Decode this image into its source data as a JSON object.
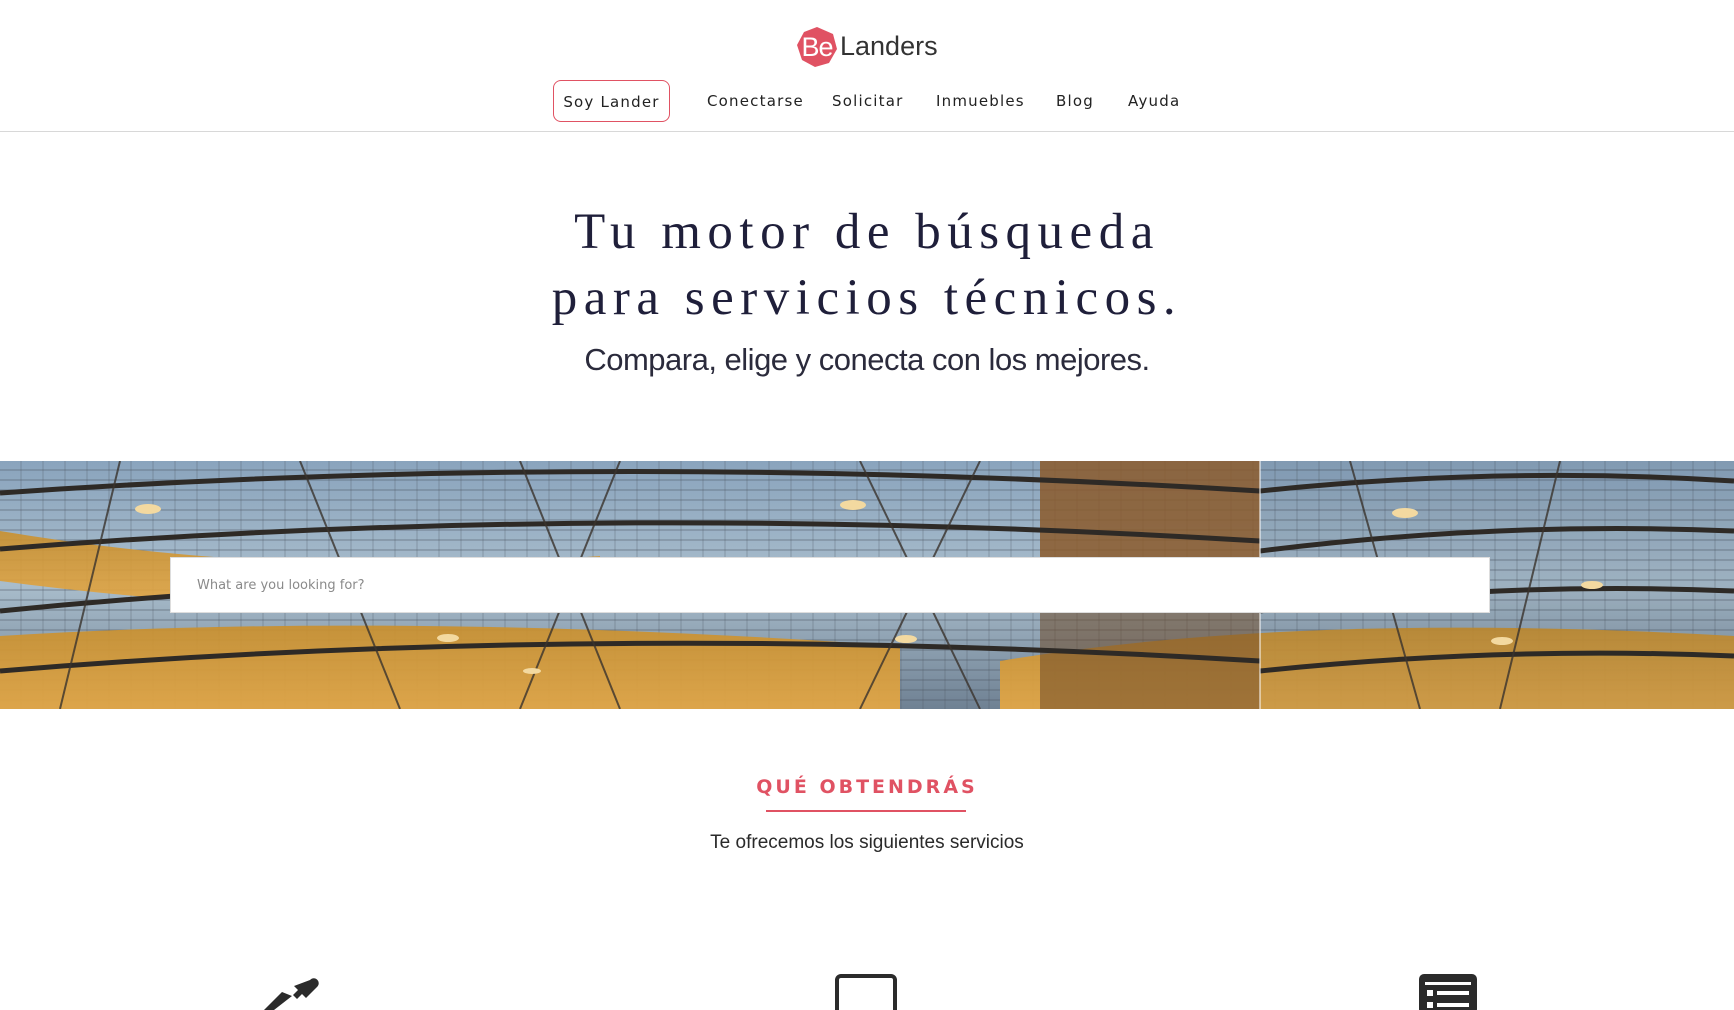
{
  "brand": {
    "logo_badge_text": "Be",
    "logo_text": "Landers",
    "accent_color": "#e05263"
  },
  "nav": {
    "items": [
      {
        "label": "Soy Lander",
        "active": true
      },
      {
        "label": "Conectarse"
      },
      {
        "label": "Solicitar"
      },
      {
        "label": "Inmuebles"
      },
      {
        "label": "Blog"
      },
      {
        "label": "Ayuda"
      }
    ]
  },
  "hero": {
    "title_line1": "Tu motor de búsqueda",
    "title_line2": "para servicios técnicos.",
    "subtitle": "Compara, elige y conecta con los mejores."
  },
  "search": {
    "placeholder": "What are you looking for?"
  },
  "section": {
    "title": "QUÉ OBTENDRÁS",
    "subtitle": "Te ofrecemos los siguientes servicios"
  },
  "features": [
    {
      "icon": "eyedropper-icon"
    },
    {
      "icon": "monitor-icon"
    },
    {
      "icon": "list-icon"
    }
  ]
}
